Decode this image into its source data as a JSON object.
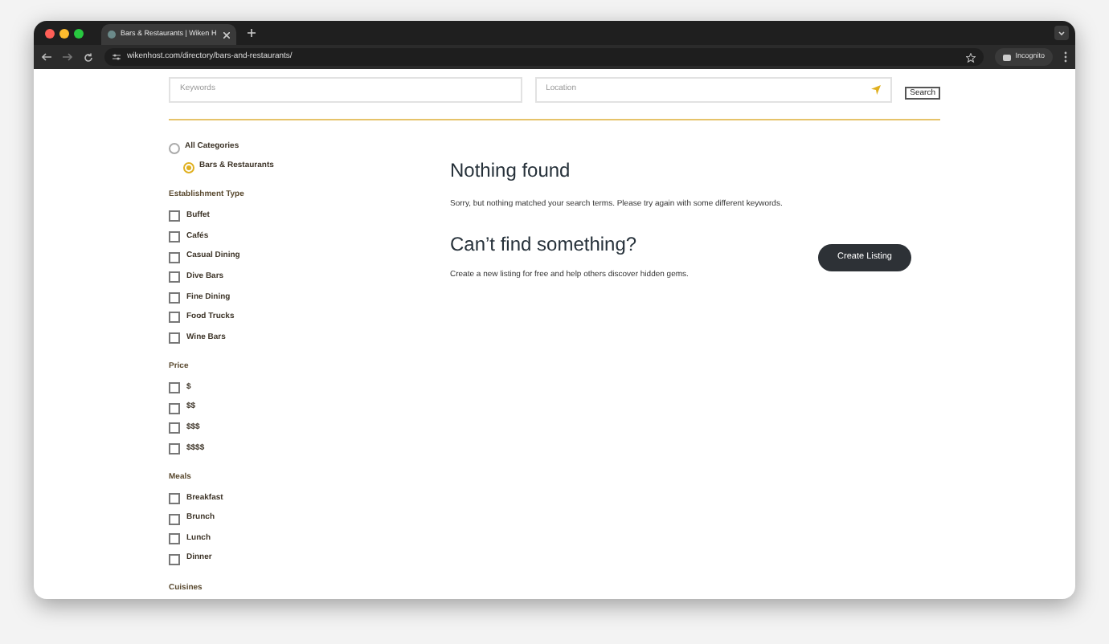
{
  "browser": {
    "tab_title": "Bars & Restaurants | Wiken H",
    "url": "wikenhost.com/directory/bars-and-restaurants/",
    "profile": "Incognito"
  },
  "search": {
    "keywords_placeholder": "Keywords",
    "location_placeholder": "Location",
    "button": "Search"
  },
  "categories": [
    {
      "label": "All Categories",
      "selected": false
    },
    {
      "label": "Bars & Restaurants",
      "selected": true
    }
  ],
  "filter_groups": [
    {
      "title": "Establishment Type",
      "options": [
        {
          "label": "Buffet",
          "checked": false
        },
        {
          "label": "Cafés",
          "checked": false
        },
        {
          "label": "Casual Dining",
          "checked": false
        },
        {
          "label": "Dive Bars",
          "checked": false
        },
        {
          "label": "Fine Dining",
          "checked": false
        },
        {
          "label": "Food Trucks",
          "checked": false
        },
        {
          "label": "Wine Bars",
          "checked": false
        }
      ]
    },
    {
      "title": "Price",
      "options": [
        {
          "label": "$",
          "checked": false
        },
        {
          "label": "$$",
          "checked": false
        },
        {
          "label": "$$$",
          "checked": false
        },
        {
          "label": "$$$$",
          "checked": false
        }
      ]
    },
    {
      "title": "Meals",
      "options": [
        {
          "label": "Breakfast",
          "checked": false
        },
        {
          "label": "Brunch",
          "checked": false
        },
        {
          "label": "Lunch",
          "checked": false
        },
        {
          "label": "Dinner",
          "checked": false
        }
      ]
    },
    {
      "title": "Cuisines"
    }
  ],
  "results": {
    "title": "Nothing found",
    "message": "Sorry, but nothing matched your search terms. Please try again with some different keywords."
  },
  "create": {
    "title": "Can’t find something?",
    "message": "Create a new listing for free and help others discover hidden gems.",
    "button": "Create Listing"
  }
}
